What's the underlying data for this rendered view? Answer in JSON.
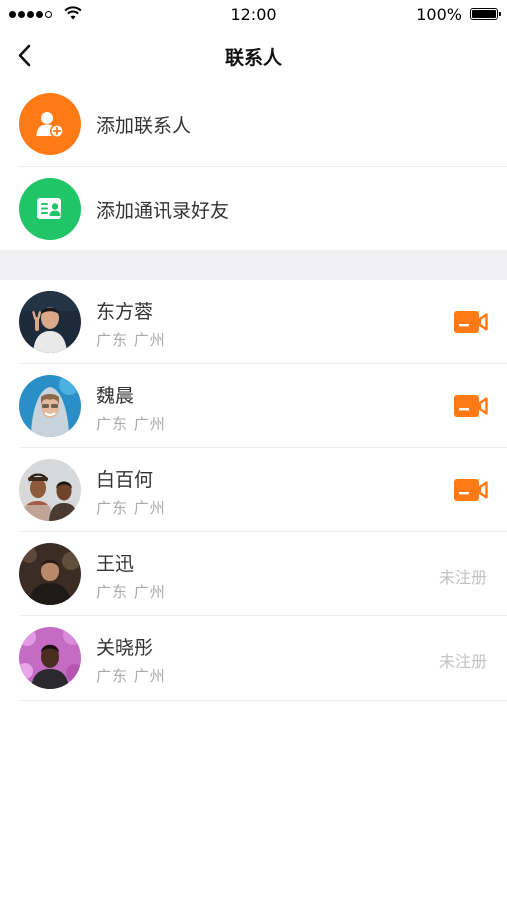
{
  "status_bar": {
    "time": "12:00",
    "battery": "100%",
    "signal_bars_filled": 4,
    "signal_bars_total": 5
  },
  "nav": {
    "title": "联系人",
    "back_icon": "chevron-left-icon"
  },
  "actions": [
    {
      "label": "添加联系人",
      "icon": "add-user-icon",
      "color": "#FF7A14"
    },
    {
      "label": "添加通讯录好友",
      "icon": "address-book-icon",
      "color": "#1FC567"
    }
  ],
  "contacts": [
    {
      "name": "东方蓉",
      "location": "广东 广州",
      "registered": true,
      "status": "",
      "action_icon": "video-call-icon"
    },
    {
      "name": "魏晨",
      "location": "广东 广州",
      "registered": true,
      "status": "",
      "action_icon": "video-call-icon"
    },
    {
      "name": "白百何",
      "location": "广东 广州",
      "registered": true,
      "status": "",
      "action_icon": "video-call-icon"
    },
    {
      "name": "王迅",
      "location": "广东 广州",
      "registered": false,
      "status": "未注册"
    },
    {
      "name": "关晓彤",
      "location": "广东 广州",
      "registered": false,
      "status": "未注册"
    }
  ],
  "colors": {
    "accent_orange": "#FF7A14",
    "accent_green": "#1FC567",
    "video_icon": "#FF7A14",
    "section_gap": "#F0F0F3"
  }
}
